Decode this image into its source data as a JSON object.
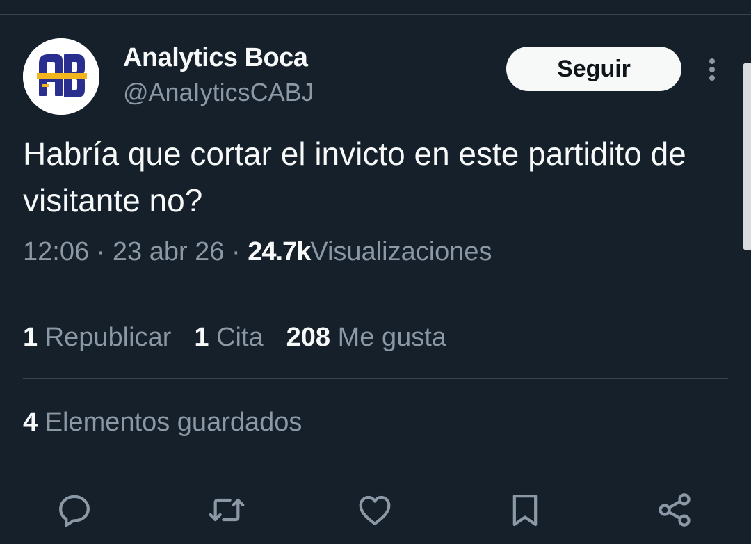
{
  "author": {
    "display_name": "Analytics Boca",
    "handle": "@AnaIyticsCABJ",
    "avatar_initials": "AB",
    "avatar_colors": {
      "blue": "#2a2f8f",
      "gold": "#f2b51d",
      "background": "#ffffff"
    }
  },
  "follow_button": {
    "label": "Seguir"
  },
  "tweet": {
    "text": "Habría que cortar el invicto en este partidito de visitante no?",
    "time": "12:06",
    "date": "23 abr 26",
    "separator": "·",
    "views_count": "24.7k",
    "views_label": "Visualizaciones"
  },
  "stats": {
    "reposts": {
      "count": "1",
      "label": "Republicar"
    },
    "quotes": {
      "count": "1",
      "label": "Cita"
    },
    "likes": {
      "count": "208",
      "label": "Me gusta"
    },
    "bookmarks": {
      "count": "4",
      "label": "Elementos guardados"
    }
  },
  "actions": [
    {
      "name": "reply-icon"
    },
    {
      "name": "repost-icon"
    },
    {
      "name": "like-icon"
    },
    {
      "name": "bookmark-icon"
    },
    {
      "name": "share-icon"
    }
  ],
  "colors": {
    "background": "#15202b",
    "primary_text": "#f7f9f9",
    "secondary_text": "#8b98a5",
    "divider": "#38444d",
    "icon": "#8b98a5"
  }
}
